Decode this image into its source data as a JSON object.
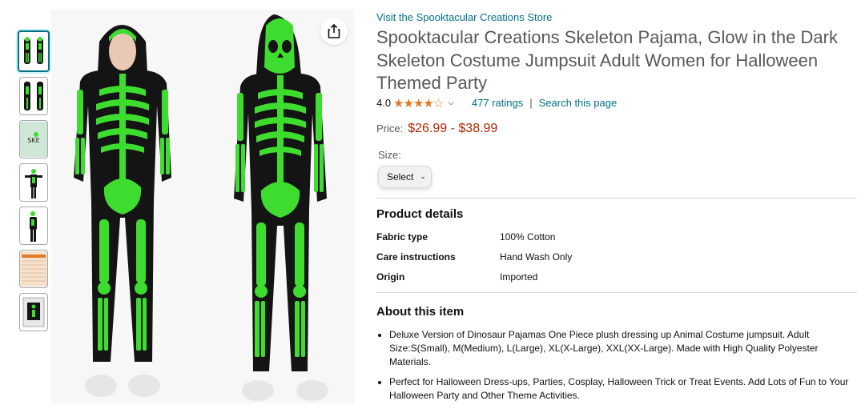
{
  "thumbnails": [
    {
      "name": "thumb-front-back",
      "selected": true
    },
    {
      "name": "thumb-side-views",
      "selected": false
    },
    {
      "name": "thumb-logo",
      "selected": false
    },
    {
      "name": "thumb-pose-arms",
      "selected": false
    },
    {
      "name": "thumb-pose-side",
      "selected": false
    },
    {
      "name": "thumb-size-chart",
      "selected": false
    },
    {
      "name": "thumb-package",
      "selected": false
    }
  ],
  "store_link": "Visit the Spooktacular Creations Store",
  "title": "Spooktacular Creations Skeleton Pajama, Glow in the Dark Skeleton Costume Jumpsuit Adult Women for Halloween Themed Party",
  "rating": {
    "value": "4.0",
    "stars": "★★★★☆",
    "ratings_count": "477 ratings",
    "search_link": "Search this page"
  },
  "price": {
    "label": "Price:",
    "range": "$26.99 - $38.99"
  },
  "size": {
    "label": "Size:",
    "select_label": "Select"
  },
  "product_details": {
    "heading": "Product details",
    "rows": [
      {
        "key": "Fabric type",
        "value": "100% Cotton"
      },
      {
        "key": "Care instructions",
        "value": "Hand Wash Only"
      },
      {
        "key": "Origin",
        "value": "Imported"
      }
    ]
  },
  "about": {
    "heading": "About this item",
    "bullets": [
      "Deluxe Version of Dinosaur Pajamas One Piece plush dressing up Animal Costume jumpsuit. Adult Size:S(Small), M(Medium), L(Large), XL(X-Large), XXL(XX-Large). Made with High Quality Polyester Materials.",
      "Perfect for Halloween Dress-ups, Parties, Cosplay, Halloween Trick or Treat Events. Add Lots of Fun to Your Halloween Party and Other Theme Activities."
    ]
  },
  "colors": {
    "link": "#007185",
    "price": "#b12704",
    "star": "#de7921",
    "glow_green": "#3ddc2f",
    "suit_black": "#141414"
  }
}
